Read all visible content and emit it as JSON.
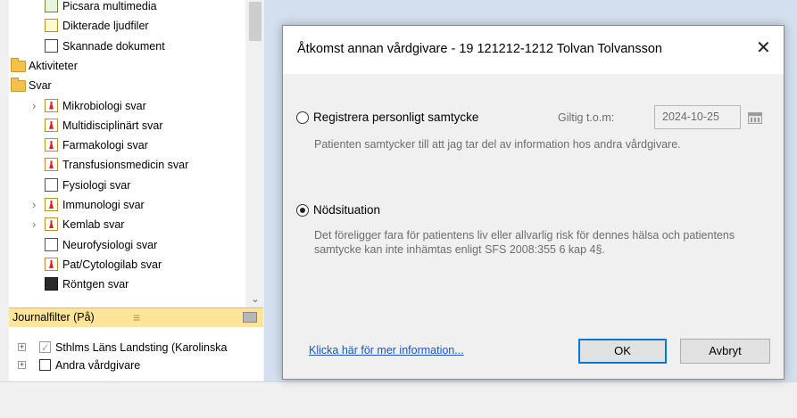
{
  "tree": {
    "items": [
      {
        "label": "Picsara multimedia",
        "icon": "image-icon"
      },
      {
        "label": "Dikterade ljudfiler",
        "icon": "sound-icon"
      },
      {
        "label": "Skannade dokument",
        "icon": "scan-icon"
      },
      {
        "label": "Aktiviteter",
        "icon": "folder-icon"
      },
      {
        "label": "Svar",
        "icon": "folder-icon"
      },
      {
        "label": "Mikrobiologi svar",
        "icon": "lab-icon",
        "expandable": true
      },
      {
        "label": "Multidisciplinärt svar",
        "icon": "lab-icon"
      },
      {
        "label": "Farmakologi svar",
        "icon": "lab-icon"
      },
      {
        "label": "Transfusionsmedicin svar",
        "icon": "lab-icon"
      },
      {
        "label": "Fysiologi svar",
        "icon": "physiology-icon"
      },
      {
        "label": "Immunologi svar",
        "icon": "lab-icon",
        "expandable": true
      },
      {
        "label": "Kemlab svar",
        "icon": "lab-icon",
        "expandable": true
      },
      {
        "label": "Neurofysiologi svar",
        "icon": "physiology-icon"
      },
      {
        "label": "Pat/Cytologilab svar",
        "icon": "lab-icon"
      },
      {
        "label": "Röntgen svar",
        "icon": "xray-icon"
      }
    ]
  },
  "filter": {
    "label": "Journalfilter (På)",
    "menu_glyph": "≡"
  },
  "caretakers": [
    {
      "label": "Sthlms Läns Landsting (Karolinska",
      "checked": true,
      "expand_glyph": "+"
    },
    {
      "label": "Andra vårdgivare",
      "checked": false,
      "expand_glyph": "+"
    }
  ],
  "dialog": {
    "title": "Åtkomst annan vårdgivare - 19 121212-1212 Tolvan Tolvansson",
    "close_glyph": "✕",
    "option_consent": {
      "label": "Registrera personligt samtycke",
      "selected": false,
      "valid_label": "Giltig t.o.m:",
      "valid_date": "2024-10-25",
      "description": "Patienten samtycker till att jag tar del av information hos andra vårdgivare."
    },
    "option_emergency": {
      "label": "Nödsituation",
      "selected": true,
      "description": "Det föreligger fara för patientens liv eller allvarlig risk för dennes hälsa och patientens samtycke kan inte inhämtas enligt SFS 2008:355 6 kap 4§."
    },
    "more_info_link": "Klicka här för mer information...",
    "ok_label": "OK",
    "cancel_label": "Avbryt"
  },
  "colors": {
    "accent": "#0078d7",
    "link": "#1a55c9",
    "filter_bar": "#fde49a",
    "background_panel": "#d3dfee"
  }
}
